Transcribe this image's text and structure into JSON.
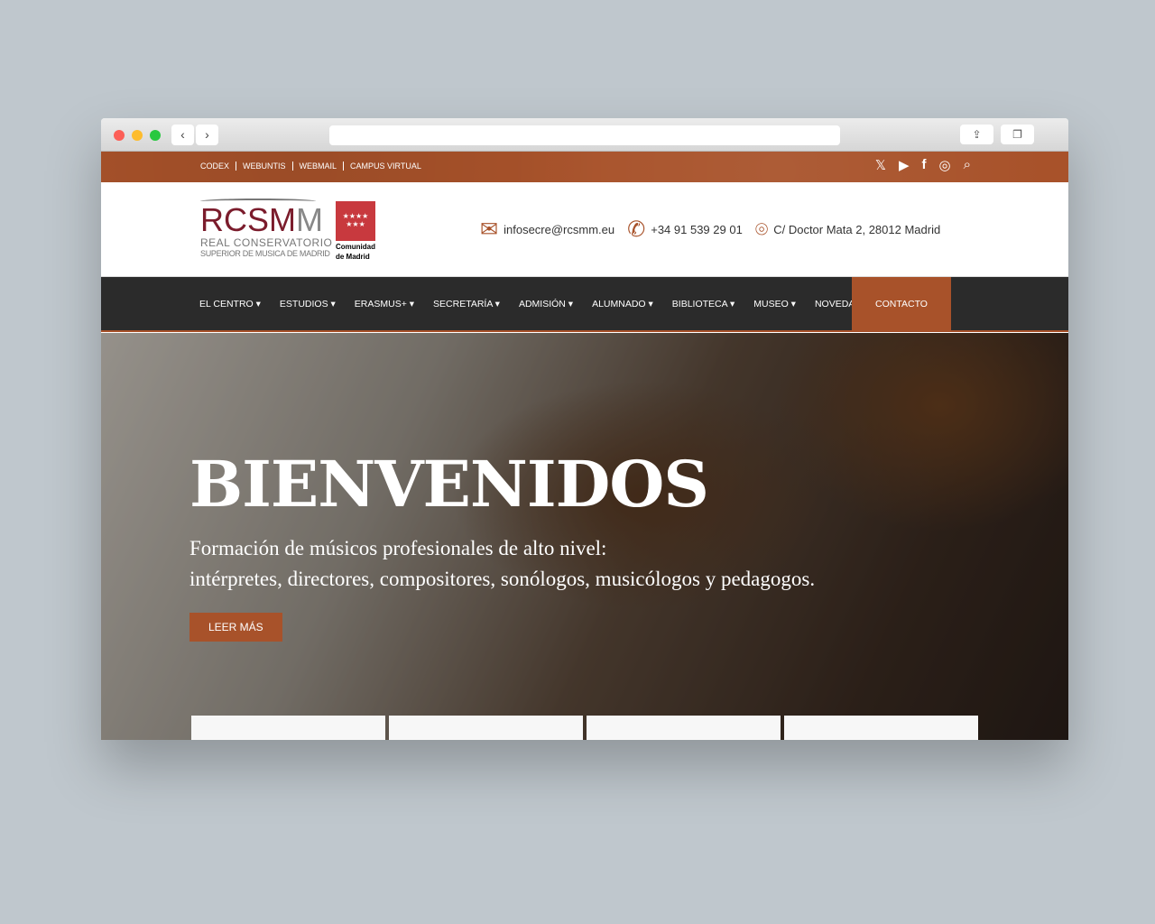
{
  "browser": {
    "back": "‹",
    "forward": "›"
  },
  "topbar": {
    "links": [
      "CODEX",
      "WEBUNTIS",
      "WEBMAIL",
      "CAMPUS VIRTUAL"
    ],
    "social": [
      "x-icon",
      "youtube-icon",
      "facebook-icon",
      "instagram-icon",
      "search-icon"
    ]
  },
  "header": {
    "logo_main": "RCSM",
    "logo_end": "M",
    "logo_line1": "REAL CONSERVATORIO",
    "logo_line2": "SUPERIOR DE MUSICA DE MADRID",
    "cm_line1": "Comunidad",
    "cm_line2": "de Madrid",
    "email": "infosecre@rcsmm.eu",
    "phone": "+34 91 539 29 01",
    "address": "C/ Doctor Mata 2, 28012 Madrid"
  },
  "nav": {
    "items": [
      "EL CENTRO ▾",
      "ESTUDIOS ▾",
      "ERASMUS+ ▾",
      "SECRETARÍA ▾",
      "ADMISIÓN ▾",
      "ALUMNADO ▾",
      "BIBLIOTECA ▾",
      "MUSEO ▾",
      "NOVEDADES"
    ],
    "contact": "CONTACTO"
  },
  "hero": {
    "title": "BIENVENIDOS",
    "line1": "Formación de músicos profesionales de alto nivel:",
    "line2": "intérpretes, directores, compositores, sonólogos, musicólogos y pedagogos.",
    "button": "LEER MÁS"
  },
  "colors": {
    "accent": "#a8522a",
    "nav_bg": "#2b2b2b",
    "logo": "#7b1c2c"
  }
}
